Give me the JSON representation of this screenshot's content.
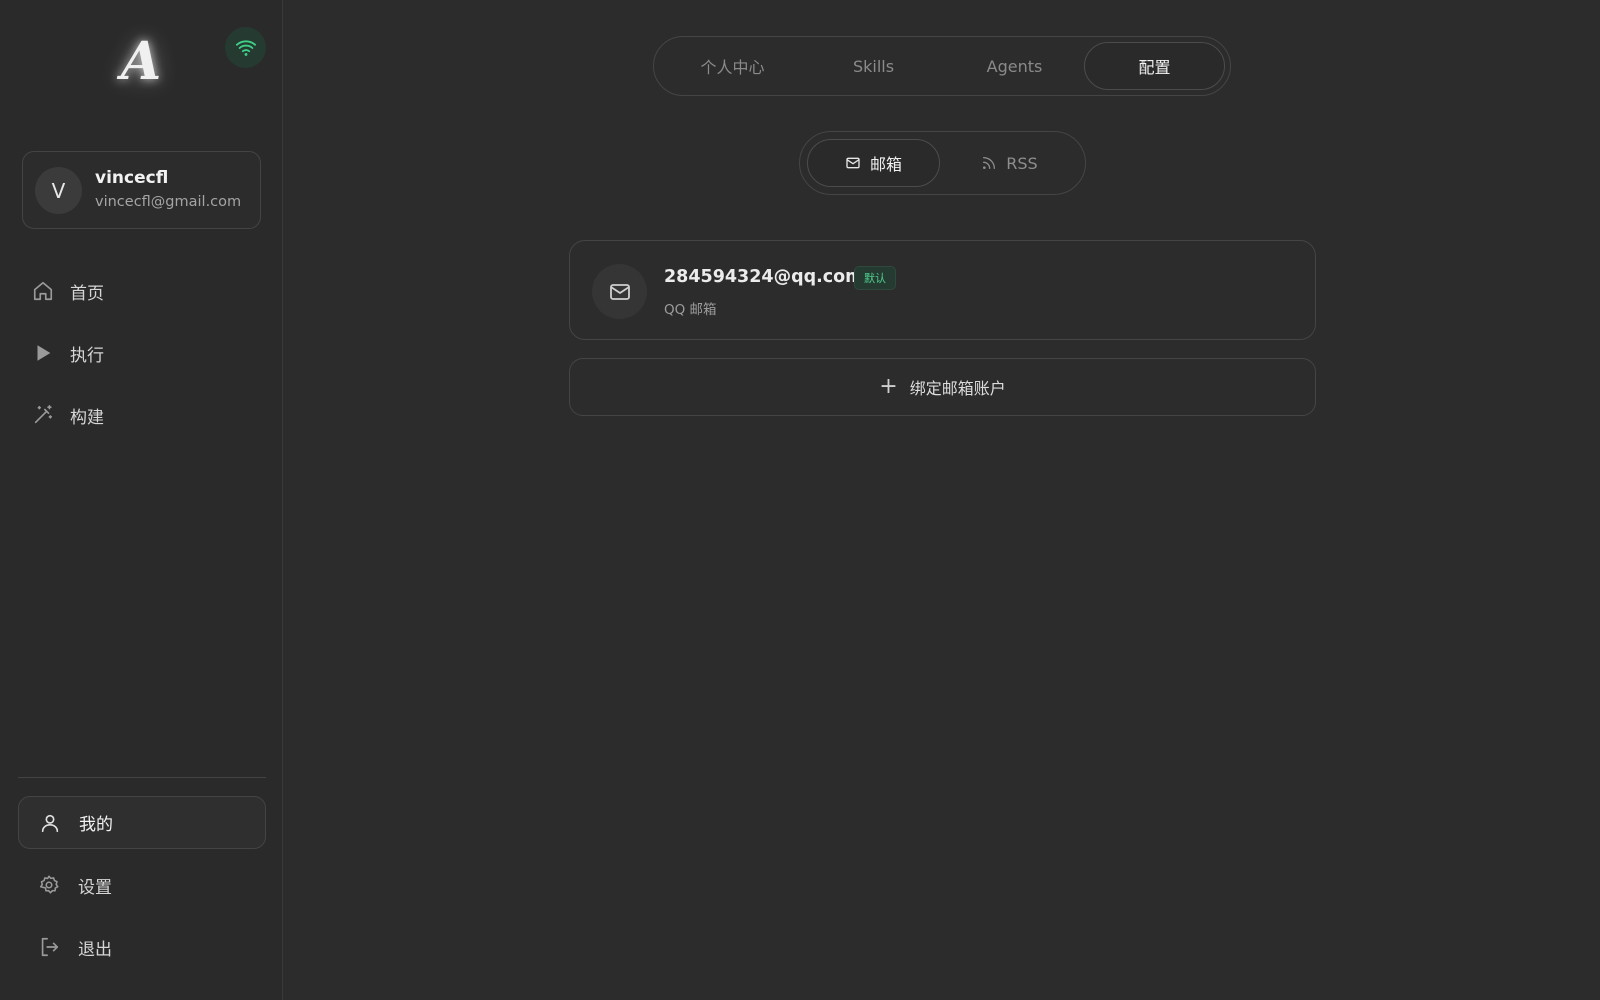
{
  "sidebar": {
    "logo_text": "A",
    "connection_icon": "wifi-icon",
    "user": {
      "avatar_letter": "V",
      "name": "vincecfl",
      "email": "vincecfl@gmail.com"
    },
    "nav": [
      {
        "label": "首页",
        "icon": "home-icon"
      },
      {
        "label": "执行",
        "icon": "play-icon"
      },
      {
        "label": "构建",
        "icon": "magic-wand-icon"
      }
    ],
    "bottom": [
      {
        "label": "我的",
        "icon": "user-icon",
        "active": true
      },
      {
        "label": "设置",
        "icon": "gear-icon"
      },
      {
        "label": "退出",
        "icon": "logout-icon"
      }
    ]
  },
  "top_tabs": [
    {
      "label": "个人中心"
    },
    {
      "label": "Skills"
    },
    {
      "label": "Agents"
    },
    {
      "label": "配置",
      "active": true
    }
  ],
  "sub_tabs": [
    {
      "label": "邮箱",
      "icon": "mail-icon",
      "active": true
    },
    {
      "label": "RSS",
      "icon": "rss-icon"
    }
  ],
  "mail_accounts": [
    {
      "address": "284594324@qq.com",
      "badge": "默认",
      "provider": "QQ 邮箱",
      "icon": "mail-icon"
    }
  ],
  "bind_button": {
    "label": "绑定邮箱账户",
    "icon": "plus-icon"
  },
  "colors": {
    "background": "#2c2c2c",
    "accent_green": "#4fcf8e",
    "border": "#454545"
  }
}
